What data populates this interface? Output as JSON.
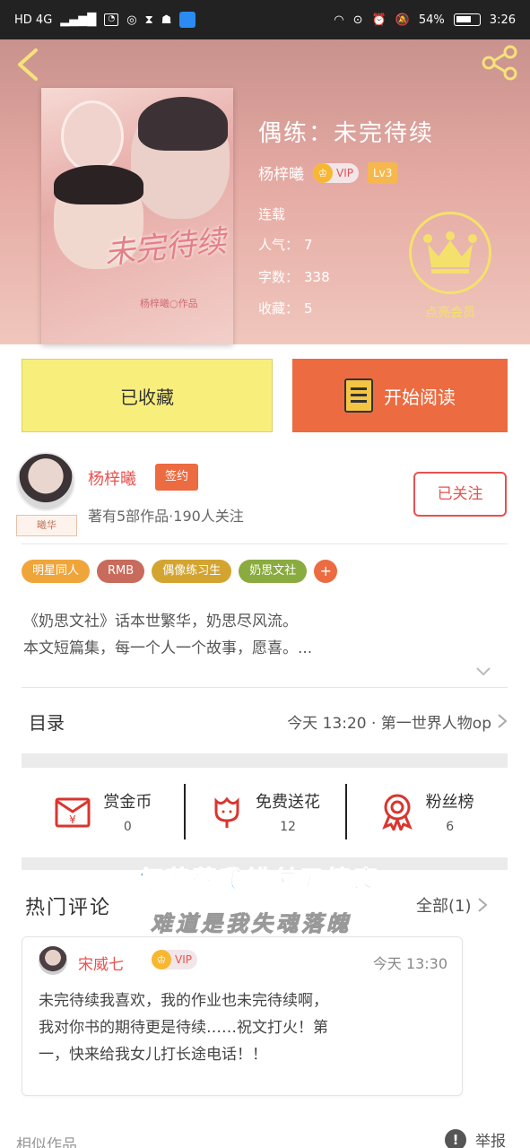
{
  "status_bar": {
    "network": "HD 4G",
    "battery": "54%",
    "time": "3:26"
  },
  "book": {
    "title": "偶练：未完待续",
    "cover_title": "未完待续",
    "cover_author": "杨梓曦○作品",
    "author": "杨梓曦",
    "vip": "VIP",
    "level": "Lv3",
    "status": "连载",
    "popularity_label": "人气：",
    "popularity": "7",
    "wordcount_label": "字数：",
    "wordcount": "338",
    "favorites_label": "收藏：",
    "favorites": "5",
    "member_label": "点亮会员"
  },
  "actions": {
    "favorited": "已收藏",
    "start_reading": "开始阅读"
  },
  "author_card": {
    "name": "杨梓曦",
    "signed": "签约",
    "avatar_tag": "曦华",
    "stats": "著有5部作品·190人关注",
    "follow": "已关注"
  },
  "tags": [
    {
      "label": "明星同人",
      "color": "#f0a53a"
    },
    {
      "label": "RMB",
      "color": "#c86b5c"
    },
    {
      "label": "偶像练习生",
      "color": "#d3a430"
    },
    {
      "label": "奶思文社",
      "color": "#8aab3f"
    }
  ],
  "tag_add": "+",
  "description": {
    "line1": "《奶思文社》话本世繁华，奶思尽风流。",
    "line2": "本文短篇集，每一个人一个故事，愿喜。..."
  },
  "toc": {
    "label": "目录",
    "latest": "今天 13:20 · 第一世界人物op"
  },
  "stats": {
    "reward": {
      "label": "赏金币",
      "value": "0"
    },
    "flowers": {
      "label": "免费送花",
      "value": "12"
    },
    "fans": {
      "label": "粉丝榜",
      "value": "6"
    }
  },
  "overlay": {
    "line1": "何苦落我错付了情衷",
    "line2": "难道是我失魂落魄"
  },
  "comments": {
    "title": "热门评论",
    "all": "全部(1)",
    "items": [
      {
        "name": "宋威七",
        "vip": "VIP",
        "time": "今天 13:30",
        "line1": "未完待续我喜欢，我的作业也未完待续啊，",
        "line2": "我对你书的期待更是待续……祝文打火！第",
        "line3": "一，快来给我女儿打长途电话！！"
      }
    ]
  },
  "footer": {
    "similar": "相似作品",
    "report": "举报",
    "report_icon": "!"
  },
  "colors": {
    "accent_orange": "#ec6b40",
    "accent_red": "#e8514f",
    "fav_yellow": "#f8ee7c",
    "gold": "#f4e16b"
  }
}
